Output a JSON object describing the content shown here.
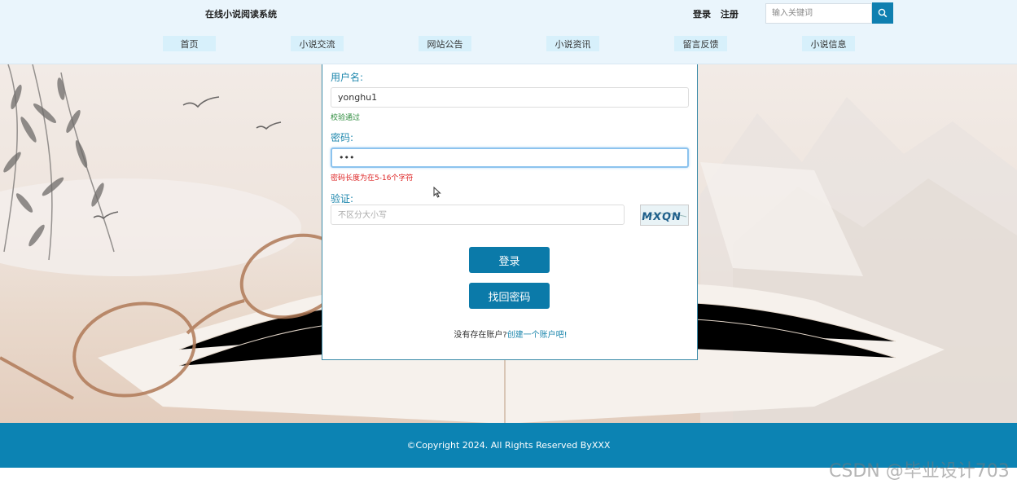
{
  "header": {
    "site_title": "在线小说阅读系统",
    "login_link": "登录",
    "register_link": "注册",
    "search_placeholder": "输入关键词",
    "search_icon": "search-icon"
  },
  "nav": {
    "items": [
      {
        "label": "首页"
      },
      {
        "label": "小说交流"
      },
      {
        "label": "网站公告"
      },
      {
        "label": "小说资讯"
      },
      {
        "label": "留言反馈"
      },
      {
        "label": "小说信息"
      }
    ]
  },
  "login_form": {
    "username_label": "用户名:",
    "username_value": "yonghu1",
    "username_hint": "校验通过",
    "password_label": "密码:",
    "password_value": "•••",
    "password_hint": "密码长度为在5-16个字符",
    "captcha_label": "验证:",
    "captcha_placeholder": "不区分大小写",
    "captcha_text": "MXQN",
    "login_button": "登录",
    "recover_button": "找回密码",
    "no_account_text": "没有存在账户?",
    "create_account_link": "创建一个账户吧!"
  },
  "footer": {
    "copyright": "©Copyright 2024. All Rights Reserved ByXXX"
  },
  "watermark": "CSDN @毕业设计703",
  "colors": {
    "primary": "#0b7aa9",
    "header_bg": "#eaf5fc",
    "nav_bg": "#d7f0fb",
    "label": "#1d87ad",
    "ok": "#2a8a3a",
    "error": "#dd2222"
  }
}
